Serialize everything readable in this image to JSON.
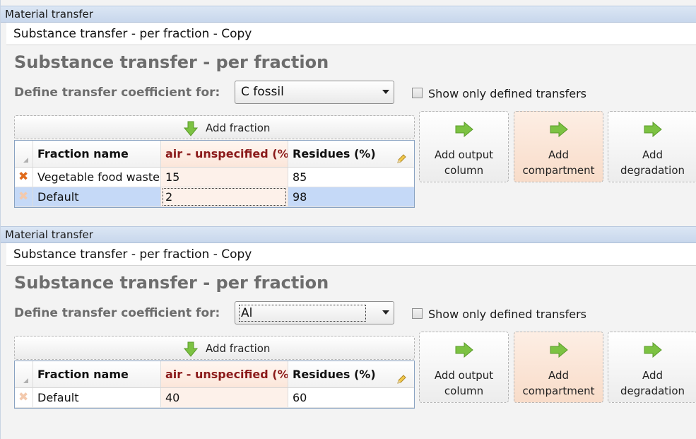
{
  "panels": [
    {
      "window_title": "Material transfer",
      "subtitle": "Substance transfer - per fraction - Copy",
      "heading": "Substance transfer - per fraction",
      "define_label": "Define transfer coefficient for:",
      "selected_substance": "C fossil",
      "show_only_defined_label": "Show only defined transfers",
      "show_only_defined_checked": false,
      "add_fraction_label": "Add fraction",
      "columns": [
        "Fraction name",
        "air - unspecified (%)",
        "Residues (%)"
      ],
      "rows": [
        {
          "name": "Vegetable food waste",
          "air": "15",
          "residues": "85",
          "delete_enabled": true
        },
        {
          "name": "Default",
          "air": "2",
          "residues": "98",
          "delete_enabled": false,
          "selected": true
        }
      ],
      "buttons": {
        "add_output_column": "Add output\ncolumn",
        "add_compartment": "Add\ncompartment",
        "add_degradation": "Add\ndegradation"
      }
    },
    {
      "window_title": "Material transfer",
      "subtitle": "Substance transfer - per fraction - Copy",
      "heading": "Substance transfer - per fraction",
      "define_label": "Define transfer coefficient for:",
      "selected_substance": "Al",
      "show_only_defined_label": "Show only defined transfers",
      "show_only_defined_checked": false,
      "add_fraction_label": "Add fraction",
      "columns": [
        "Fraction name",
        "air - unspecified (%)",
        "Residues (%)"
      ],
      "rows": [
        {
          "name": "Default",
          "air": "40",
          "residues": "60",
          "delete_enabled": false
        }
      ],
      "buttons": {
        "add_output_column": "Add output\ncolumn",
        "add_compartment": "Add\ncompartment",
        "add_degradation": "Add\ndegradation"
      }
    }
  ],
  "colors": {
    "accent_column_header": "#8b1a1a",
    "arrow_green": "#7cc242",
    "delete_orange": "#e06a1a",
    "selection": "#c5d9f7"
  },
  "icons": {
    "add_fraction": "green-down-arrow-icon",
    "add_button": "green-right-arrow-icon",
    "delete_row": "orange-x-icon",
    "edit_columns": "pencil-icon"
  }
}
